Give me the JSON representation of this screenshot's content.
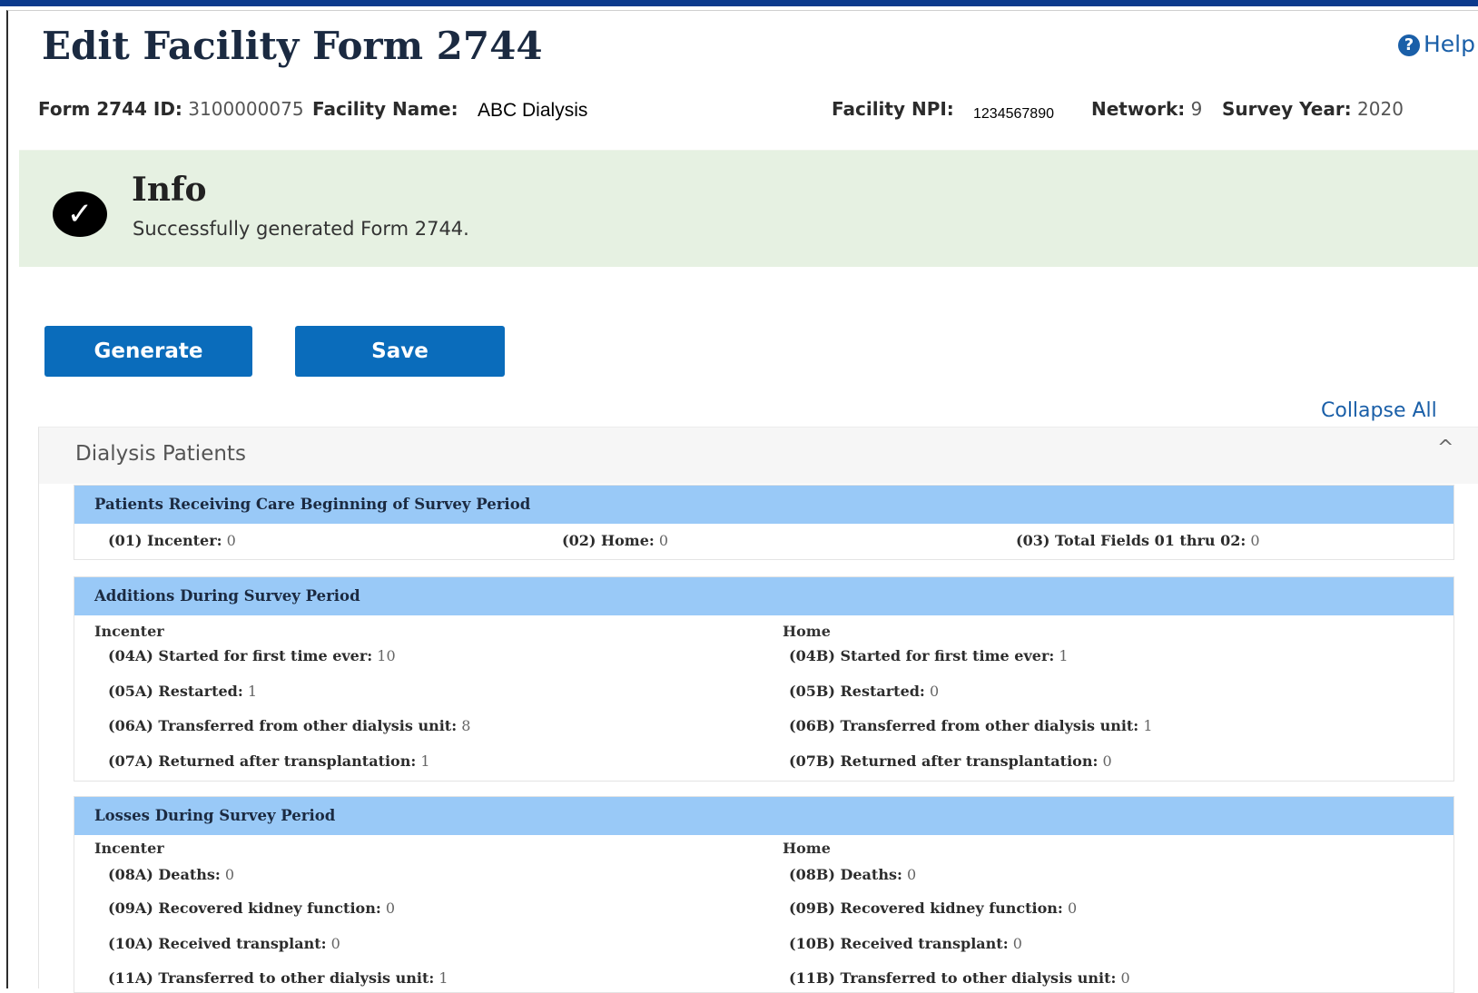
{
  "header": {
    "title": "Edit Facility Form 2744",
    "help_label": "Help"
  },
  "meta": {
    "form_id_label": "Form 2744 ID:",
    "form_id": "3100000075",
    "facility_name_label": "Facility Name:",
    "facility_name": "ABC Dialysis",
    "npi_label": "Facility NPI:",
    "npi": "1234567890",
    "network_label": "Network:",
    "network": "9",
    "survey_year_label": "Survey Year:",
    "survey_year": "2020"
  },
  "info": {
    "title": "Info",
    "message": "Successfully generated Form 2744."
  },
  "actions": {
    "generate": "Generate",
    "save": "Save",
    "collapse_all": "Collapse All"
  },
  "accordion": {
    "title": "Dialysis Patients",
    "sections": {
      "beginning": {
        "title": "Patients Receiving Care Beginning of Survey Period",
        "fields": [
          {
            "label": "(01) Incenter:",
            "value": "0"
          },
          {
            "label": "(02) Home:",
            "value": "0"
          },
          {
            "label": "(03) Total Fields 01 thru 02:",
            "value": "0"
          }
        ]
      },
      "additions": {
        "title": "Additions During Survey Period",
        "incenter_label": "Incenter",
        "home_label": "Home",
        "incenter": [
          {
            "label": "(04A) Started for first time ever:",
            "value": "10"
          },
          {
            "label": "(05A) Restarted:",
            "value": "1"
          },
          {
            "label": "(06A) Transferred from other dialysis unit:",
            "value": "8"
          },
          {
            "label": "(07A) Returned after transplantation:",
            "value": "1"
          }
        ],
        "home": [
          {
            "label": "(04B) Started for first time ever:",
            "value": "1"
          },
          {
            "label": "(05B) Restarted:",
            "value": "0"
          },
          {
            "label": "(06B) Transferred from other dialysis unit:",
            "value": "1"
          },
          {
            "label": "(07B) Returned after transplantation:",
            "value": "0"
          }
        ]
      },
      "losses": {
        "title": "Losses During Survey Period",
        "incenter_label": "Incenter",
        "home_label": "Home",
        "incenter": [
          {
            "label": "(08A) Deaths:",
            "value": "0"
          },
          {
            "label": "(09A) Recovered kidney function:",
            "value": "0"
          },
          {
            "label": "(10A) Received transplant:",
            "value": "0"
          },
          {
            "label": "(11A) Transferred to other dialysis unit:",
            "value": "1"
          }
        ],
        "home": [
          {
            "label": "(08B) Deaths:",
            "value": "0"
          },
          {
            "label": "(09B) Recovered kidney function:",
            "value": "0"
          },
          {
            "label": "(10B) Received transplant:",
            "value": "0"
          },
          {
            "label": "(11B) Transferred to other dialysis unit:",
            "value": "0"
          }
        ]
      }
    }
  }
}
